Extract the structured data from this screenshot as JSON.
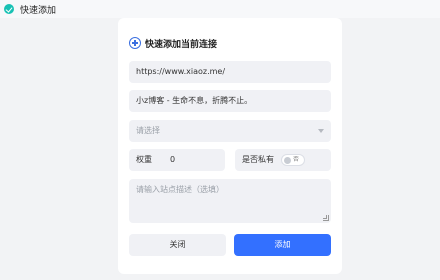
{
  "window": {
    "title": "快速添加"
  },
  "form": {
    "heading": "快速添加当前连接",
    "url_value": "https://www.xiaoz.me/",
    "name_value": "小z博客 - 生命不息，折腾不止。",
    "category_placeholder": "请选择",
    "weight_label": "权重",
    "weight_value": "0",
    "private_label": "是否私有",
    "private_switch_text": "否",
    "description_placeholder": "请输入站点描述（选填）",
    "close_label": "关闭",
    "add_label": "添加"
  },
  "colors": {
    "accent": "#3370ff",
    "logo": "#18c1b4"
  },
  "icons": {
    "app": "app-logo-icon",
    "heading": "plus-circle-icon",
    "select": "chevron-down-icon"
  }
}
